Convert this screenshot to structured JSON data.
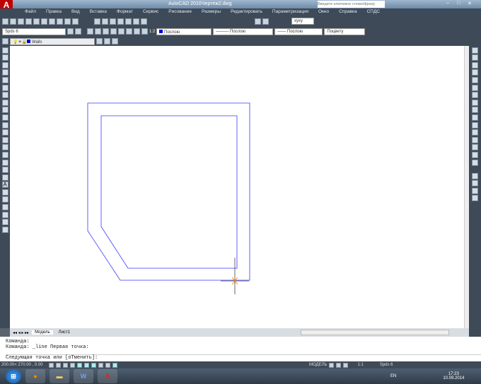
{
  "window": {
    "app": "AutoCAD 2010",
    "file": "Чертеж2.dwg",
    "search_placeholder": "Введите ключевое слово/фразу",
    "user": "хуху"
  },
  "menu": [
    "Файл",
    "Правка",
    "Вид",
    "Вставка",
    "Формат",
    "Сервис",
    "Рисование",
    "Размеры",
    "Редактировать",
    "Параметризация",
    "Окно",
    "Справка",
    "СПДС"
  ],
  "toolbar2": {
    "style": "Spds 6",
    "scale": "1:2",
    "color": "Послою",
    "linetype": "Послою",
    "lineweight": "Послою",
    "plotstyle": "Поцвету"
  },
  "toolbar3": {
    "layer": "Walls"
  },
  "tabs": [
    "Модель",
    "Лист1"
  ],
  "command": {
    "lines": [
      "Команда:",
      "Команда: _line Первая точка:"
    ],
    "prompt": "Следующая точка или [оТменить]:"
  },
  "status": {
    "coords": "200.00< 270.00 , 0.00",
    "model": "МОДЕЛЬ",
    "annoscale": "1:1",
    "workspace": "Spds 6"
  },
  "taskbar": {
    "lang": "EN",
    "time": "17:23",
    "date": "10.09.2014",
    "apps": [
      "windows-start",
      "firefox",
      "explorer",
      "word",
      "autocad"
    ]
  },
  "colors": {
    "drawing_line": "#3a3aff",
    "cursor": "#ff8800",
    "accent": "#c00000"
  }
}
